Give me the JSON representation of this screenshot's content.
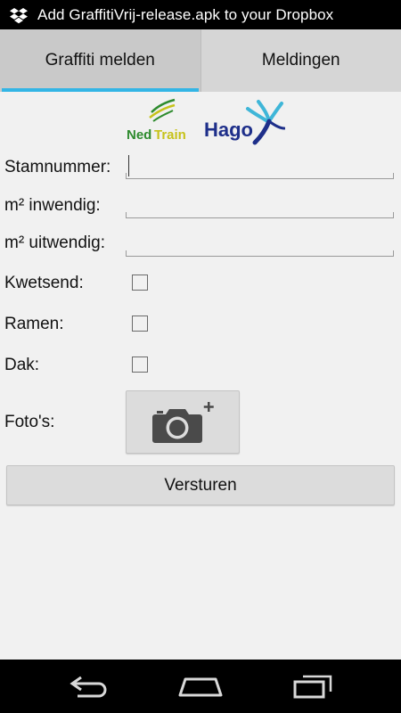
{
  "status_bar": {
    "icon": "dropbox-icon",
    "message": "Add GraffitiVrij-release.apk to your Dropbox"
  },
  "tabs": [
    {
      "label": "Graffiti melden",
      "active": true
    },
    {
      "label": "Meldingen",
      "active": false
    }
  ],
  "logos": {
    "nedtrain_part1": "Ned",
    "nedtrain_part2": "Train",
    "hago": "Hago"
  },
  "form": {
    "stamnummer_label": "Stamnummer:",
    "stamnummer_value": "",
    "m2_inwendig_label": "m² inwendig:",
    "m2_inwendig_value": "",
    "m2_uitwendig_label": "m² uitwendig:",
    "m2_uitwendig_value": "",
    "kwetsend_label": "Kwetsend:",
    "kwetsend_checked": false,
    "ramen_label": "Ramen:",
    "ramen_checked": false,
    "dak_label": "Dak:",
    "dak_checked": false,
    "fotos_label": "Foto's:",
    "photo_button_icon": "camera-add-icon",
    "submit_label": "Versturen"
  },
  "nav_bar": {
    "icons": [
      "back-icon",
      "home-icon",
      "recent-apps-icon"
    ]
  },
  "colors": {
    "tab_indicator": "#33b5e5",
    "nedtrain_green": "#2e8b2e",
    "nedtrain_yellow": "#c6c21a",
    "hago_blue": "#1e2f8a",
    "hago_cyan": "#3fb6d8"
  }
}
